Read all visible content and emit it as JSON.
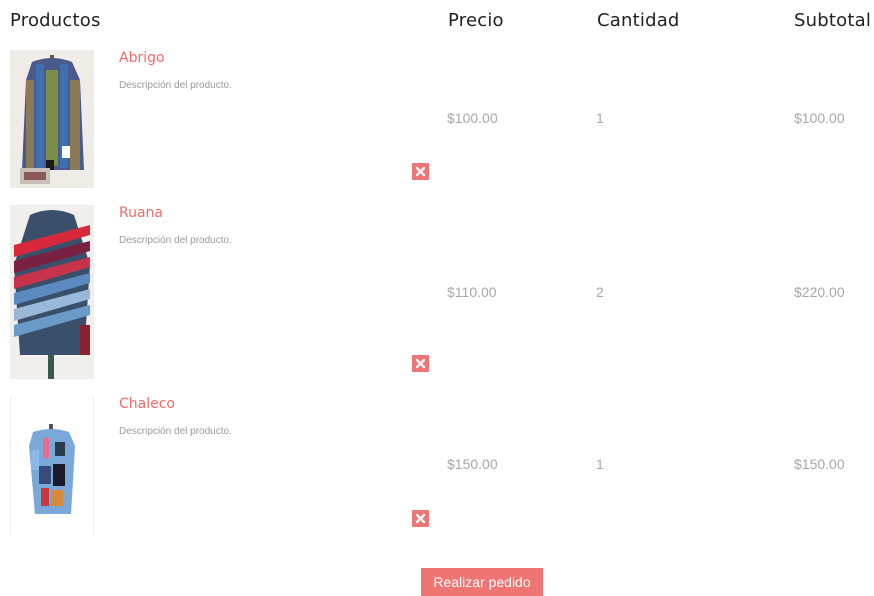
{
  "headers": {
    "products": "Productos",
    "price": "Precio",
    "quantity": "Cantidad",
    "subtotal": "Subtotal"
  },
  "items": [
    {
      "name": "Abrigo",
      "description": "Descripción del producto.",
      "price": "$100.00",
      "quantity": "1",
      "subtotal": "$100.00"
    },
    {
      "name": "Ruana",
      "description": "Descripción del producto.",
      "price": "$110.00",
      "quantity": "2",
      "subtotal": "$220.00"
    },
    {
      "name": "Chaleco",
      "description": "Descripción del producto.",
      "price": "$150.00",
      "quantity": "1",
      "subtotal": "$150.00"
    }
  ],
  "actions": {
    "order_button": "Realizar pedido"
  },
  "colors": {
    "accent": "#ef7474",
    "muted_text": "#a8a8a8",
    "header_text": "#222222"
  },
  "icons": {
    "remove": "close-icon"
  }
}
